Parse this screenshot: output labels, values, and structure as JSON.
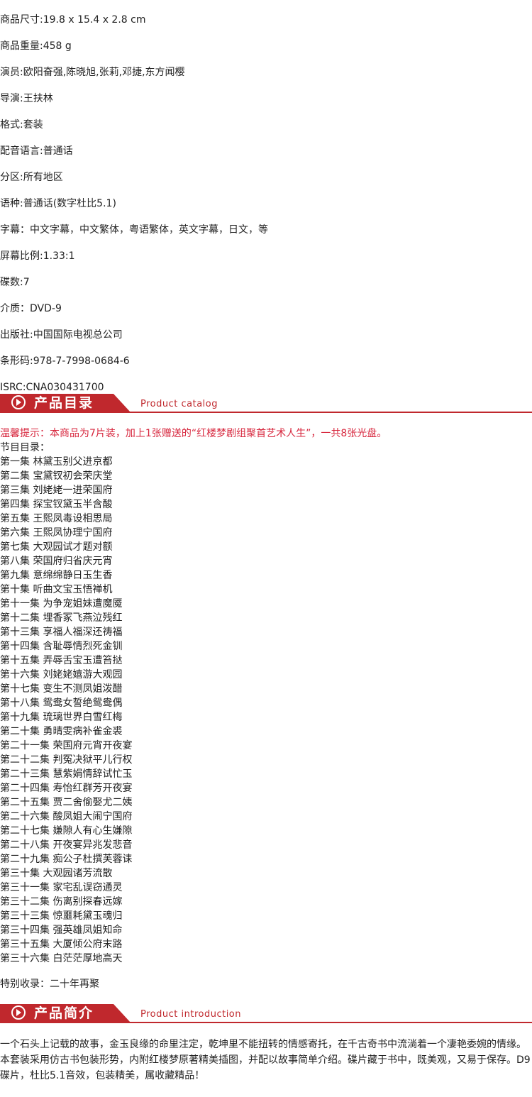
{
  "specs": [
    "商品尺寸:19.8 x 15.4 x 2.8 cm",
    "商品重量:458 g",
    "演员:欧阳奋强,陈晓旭,张莉,邓捷,东方闻樱",
    "导演:王扶林",
    "格式:套装",
    "配音语言:普通话",
    "分区:所有地区",
    "语种:普通话(数字杜比5.1)",
    "字幕：中文字幕，中文繁体，粤语繁体，英文字幕，日文，等",
    "屏幕比例:1.33:1",
    "碟数:7",
    "介质：DVD-9",
    "出版社:中国国际电视总公司",
    "条形码:978-7-7998-0684-6",
    "ISRC:CNA030431700"
  ],
  "catalog_section": {
    "title_cn": "产品目录",
    "title_en": "Product catalog"
  },
  "notice": "温馨提示：本商品为7片装，加上1张赠送的“红楼梦剧组聚首艺术人生”，一共8张光盘。",
  "catalog_heading": "节目目录：",
  "episodes": [
    "第一集 林黛玉别父进京都",
    "第二集 宝黛钗初会荣庆堂",
    "第三集 刘姥姥一进荣国府",
    "第四集 探宝钗黛玉半含酸",
    "第五集 王熙凤毒设相思局",
    "第六集 王熙凤协理宁国府",
    "第七集 大观园试才题对额",
    "第八集 荣国府归省庆元宵",
    "第九集 意绵绵静日玉生香",
    "第十集 听曲文宝玉悟禅机",
    "第十一集 为争宠姐妹遭魔魇",
    "第十二集 埋香冢飞燕泣残红",
    "第十三集 享福人福深还祷福",
    "第十四集 含耻辱情烈死金钏",
    "第十五集 弄辱舌宝玉遭笞挞",
    "第十六集 刘姥姥嬉游大观园",
    "第十七集 变生不测凤姐泼醋",
    "第十八集 鸳鸯女誓绝鸳鸯偶",
    "第十九集 琉璃世界白雪红梅",
    "第二十集 勇晴雯病补雀金裘",
    "第二十一集 荣国府元宵开夜宴",
    "第二十二集 判冤决狱平儿行权",
    "第二十三集 慧紫娟情辞试忙玉",
    "第二十四集 寿怡红群芳开夜宴",
    "第二十五集 贾二舍偷娶尤二姨",
    "第二十六集 酸凤姐大闹宁国府",
    "第二十七集 嫌隙人有心生嫌隙",
    "第二十八集 开夜宴异兆发悲音",
    "第二十九集 痴公子杜撰芙蓉诔",
    "第三十集 大观园诸芳流散",
    "第三十一集 家宅乱误窃通灵",
    "第三十二集 伤离别探春远嫁",
    "第三十三集 惊噩耗黛玉魂归",
    "第三十四集 强英雄凤姐知命",
    "第三十五集 大厦倾公府末路",
    "第三十六集 白茫茫厚地高天"
  ],
  "special": "特别收录：二十年再聚",
  "intro_section": {
    "title_cn": "产品简介",
    "title_en": "Product introduction"
  },
  "intro_text": "一个石头上记载的故事，金玉良缘的命里注定，乾坤里不能扭转的情感寄托，在千古奇书中流淌着一个凄艳委婉的情缘。本套装采用仿古书包装形势，内附红楼梦原著精美插图，并配以故事简单介绍。碟片藏于书中，既美观，又易于保存。D9碟片，杜比5.1音效，包装精美，属收藏精品！",
  "colors": {
    "banner_red": "#c0282d",
    "notice_red": "#d7263d",
    "text": "#222222"
  }
}
